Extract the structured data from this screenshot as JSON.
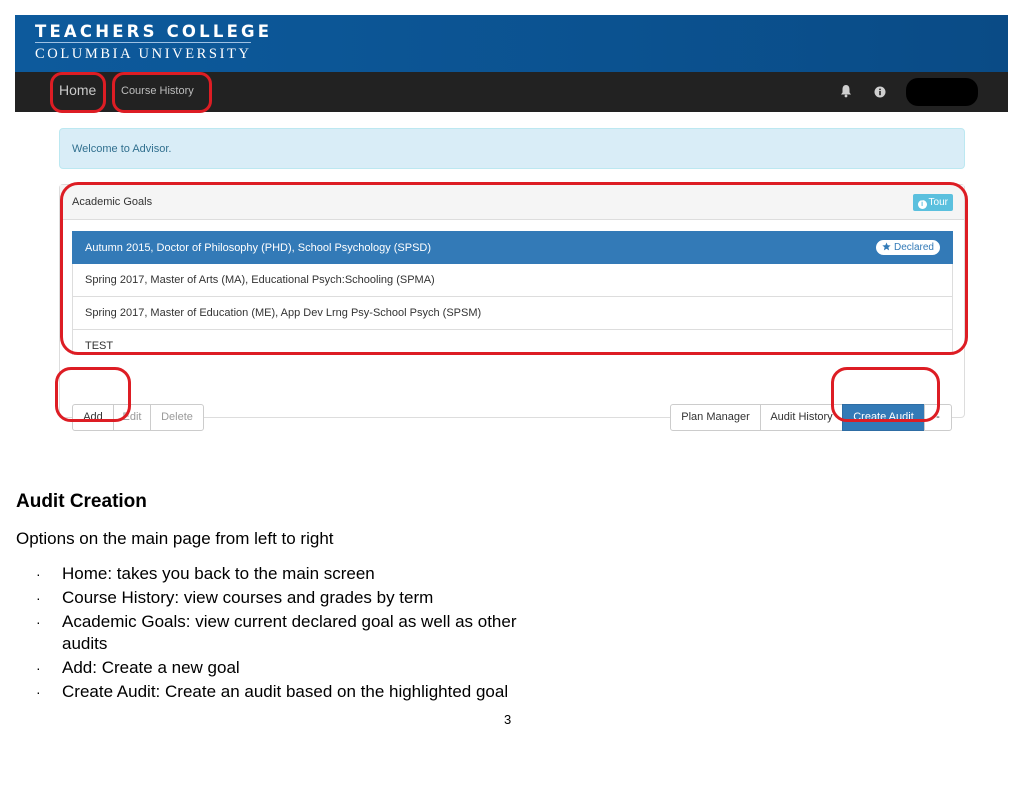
{
  "header": {
    "brand_line1": "TEACHERS COLLEGE",
    "brand_line2": "COLUMBIA UNIVERSITY",
    "colors": {
      "brand_blue": "#0b5290",
      "navbar": "#222222"
    }
  },
  "navbar": {
    "items": [
      {
        "label": "Home"
      },
      {
        "label": "Course History"
      }
    ],
    "icons": [
      "bell-icon",
      "info-icon"
    ],
    "user_menu": "redacted"
  },
  "alert": {
    "text": "Welcome to Advisor."
  },
  "academic_goals": {
    "title": "Academic Goals",
    "tour_label": "Tour",
    "goals": [
      {
        "label": "Autumn 2015, Doctor of Philosophy (PHD), School Psychology (SPSD)",
        "badge": "Declared",
        "selected": true
      },
      {
        "label": "Spring 2017, Master of Arts (MA), Educational Psych:Schooling (SPMA)"
      },
      {
        "label": "Spring 2017, Master of Education (ME), App Dev Lrng Psy-School Psych (SPSM)"
      },
      {
        "label": "TEST"
      }
    ],
    "left_buttons": [
      {
        "label": "Add",
        "enabled": true
      },
      {
        "label": "Edit",
        "enabled": false
      },
      {
        "label": "Delete",
        "enabled": false
      }
    ],
    "right_buttons": [
      {
        "label": "Plan Manager"
      },
      {
        "label": "Audit History"
      },
      {
        "label": "Create Audit"
      },
      {
        "label": "-"
      }
    ],
    "colors": {
      "primary": "#337ab7",
      "info": "#5bc0de",
      "alert_bg": "#d9edf7",
      "highlight": "#dd1d24"
    }
  },
  "document": {
    "title": "Audit Creation",
    "intro": "Options on the main page from left to right",
    "bullet_char": "·",
    "bullets": [
      "Home: takes you back to the main screen",
      "Course History: view courses and grades by term",
      "Academic Goals: view current declared goal as well as other audits",
      "Add: Create a new goal",
      "Create Audit: Create an audit based on the highlighted goal"
    ],
    "page_number": "3"
  }
}
